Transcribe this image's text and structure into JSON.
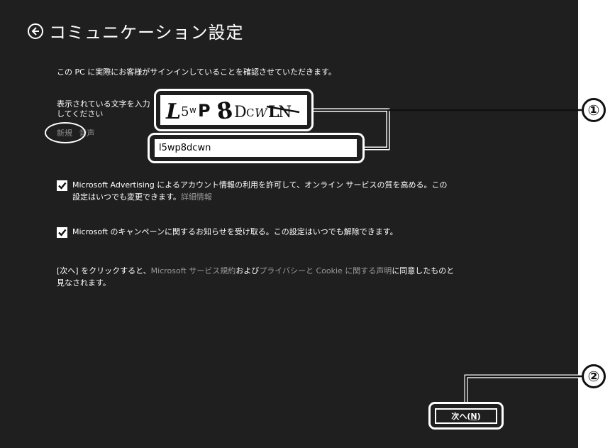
{
  "page": {
    "title": "コミュニケーション設定",
    "intro": "この PC に実際にお客様がサインインしていることを確認させていただきます。"
  },
  "captcha": {
    "label": "表示されている文字を入力してください",
    "new_link": "新規",
    "audio_link": "音声",
    "image_text": "L5wP8DCWLN",
    "input_value": "l5wp8dcwn"
  },
  "checkboxes": [
    {
      "checked": true,
      "line1": "Microsoft Advertising によるアカウント情報の利用を許可して、オンライン サービスの質を高める。この",
      "line2": "設定はいつでも変更できます。",
      "link": "詳細情報"
    },
    {
      "checked": true,
      "line1": "Microsoft のキャンペーンに関するお知らせを受け取る。この設定はいつでも解除できます。"
    }
  ],
  "terms": {
    "prefix": "[次へ] をクリックすると、",
    "link1": "Microsoft サービス規約",
    "mid": "および",
    "link2": "プライバシーと Cookie に関する声明",
    "suffix": "に同意したものと",
    "line2": "見なされます。"
  },
  "next_button": {
    "label": "次へ(",
    "key": "N",
    "close": ")"
  },
  "callouts": [
    "①",
    "②"
  ],
  "colors": {
    "background": "#1f1f1f",
    "text": "#ffffff",
    "link": "#9a9a9a",
    "callout": "#111111"
  }
}
